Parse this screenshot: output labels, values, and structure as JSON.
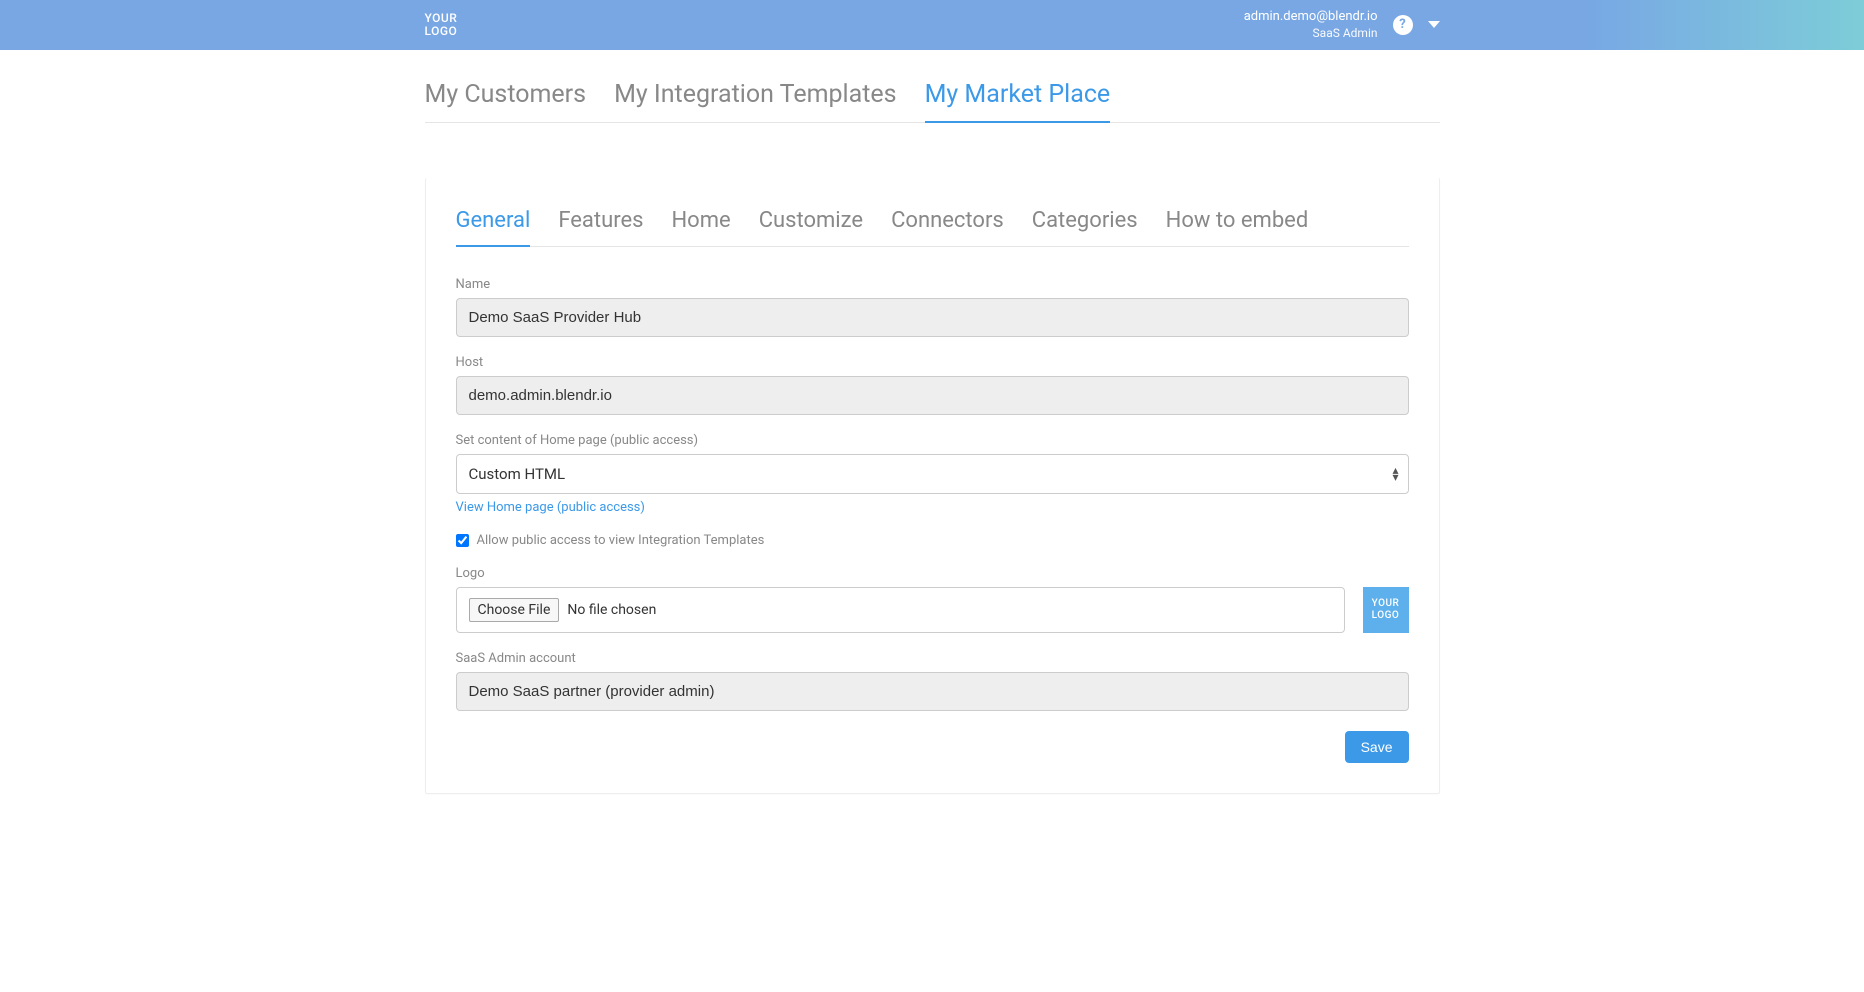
{
  "header": {
    "logo_line1": "YOUR",
    "logo_line2": "LOGO",
    "user_email": "admin.demo@blendr.io",
    "user_role": "SaaS Admin",
    "help_icon_glyph": "?"
  },
  "top_tabs": [
    {
      "label": "My Customers",
      "active": false
    },
    {
      "label": "My Integration Templates",
      "active": false
    },
    {
      "label": "My Market Place",
      "active": true
    }
  ],
  "sub_tabs": [
    {
      "label": "General",
      "active": true
    },
    {
      "label": "Features",
      "active": false
    },
    {
      "label": "Home",
      "active": false
    },
    {
      "label": "Customize",
      "active": false
    },
    {
      "label": "Connectors",
      "active": false
    },
    {
      "label": "Categories",
      "active": false
    },
    {
      "label": "How to embed",
      "active": false
    }
  ],
  "form": {
    "name_label": "Name",
    "name_value": "Demo SaaS Provider Hub",
    "host_label": "Host",
    "host_value": "demo.admin.blendr.io",
    "home_content_label": "Set content of Home page (public access)",
    "home_content_value": "Custom HTML",
    "view_home_link": "View Home page (public access)",
    "allow_public_label": "Allow public access to view Integration Templates",
    "allow_public_checked": true,
    "logo_label": "Logo",
    "choose_file_label": "Choose File",
    "no_file_text": "No file chosen",
    "logo_preview_line1": "YOUR",
    "logo_preview_line2": "LOGO",
    "saas_admin_label": "SaaS Admin account",
    "saas_admin_value": "Demo SaaS partner (provider admin)",
    "save_button": "Save"
  }
}
